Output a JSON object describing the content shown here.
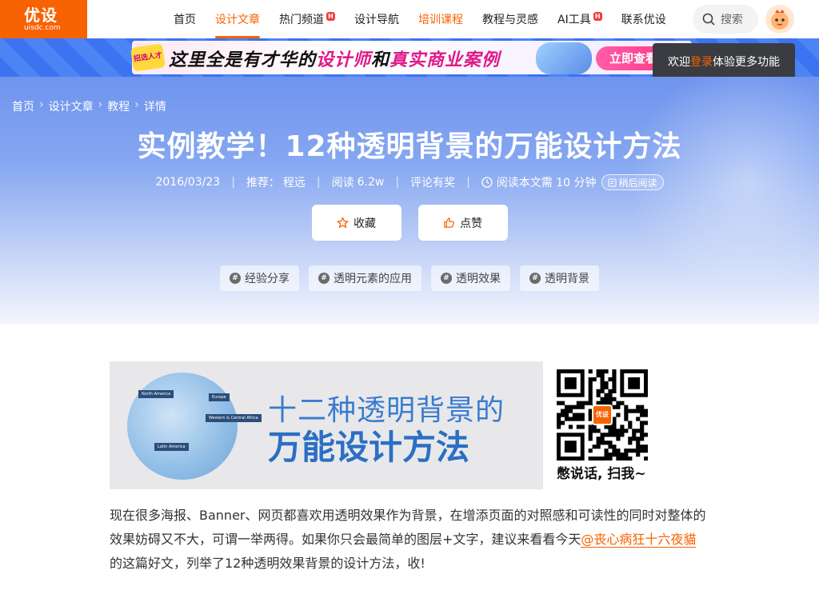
{
  "header": {
    "logo_main": "优设",
    "logo_sub": "uisdc.com",
    "nav": [
      {
        "label": "首页",
        "hot": false,
        "state": "normal"
      },
      {
        "label": "设计文章",
        "hot": false,
        "state": "active"
      },
      {
        "label": "热门频道",
        "hot": true,
        "state": "normal"
      },
      {
        "label": "设计导航",
        "hot": false,
        "state": "normal"
      },
      {
        "label": "培训课程",
        "hot": false,
        "state": "highlight"
      },
      {
        "label": "教程与灵感",
        "hot": false,
        "state": "normal"
      },
      {
        "label": "AI工具",
        "hot": true,
        "state": "normal"
      },
      {
        "label": "联系优设",
        "hot": false,
        "state": "normal"
      }
    ],
    "hot_badge": "H",
    "search_label": "搜索"
  },
  "ad": {
    "tag": "招选人才",
    "text_1": "这里全是有才华的",
    "text_2": "设计师",
    "text_3": "和",
    "text_4": "真实商业案例",
    "cta": "立即查看"
  },
  "tooltip": {
    "pre": "欢迎",
    "login": "登录",
    "post": "体验更多功能"
  },
  "breadcrumb": [
    "首页",
    "设计文章",
    "教程",
    "详情"
  ],
  "article": {
    "title": "实例教学！12种透明背景的万能设计方法",
    "date": "2016/03/23",
    "recommend_label": "推荐：",
    "recommender": "程远",
    "read_label": "阅读",
    "read_count": "6.2w",
    "comment": "评论有奖",
    "read_time": "阅读本文需 10 分钟",
    "read_later": "稍后阅读",
    "fav_label": "收藏",
    "like_label": "点赞",
    "tags": [
      "经验分享",
      "透明元素的应用",
      "透明效果",
      "透明背景"
    ],
    "banner_line1": "十二种透明背景的",
    "banner_line2": "万能设计方法",
    "globe_labels": [
      "North America",
      "Europe",
      "Western & Central Africa",
      "Latin America"
    ],
    "qr_logo": "优设",
    "qr_caption": "憋说话, 扫我~",
    "para_1": "现在很多海报、Banner、网页都喜欢用透明效果作为背景，在增添页面的对照感和可读性的同时对整体的效果妨碍又不大，可谓一举两得。如果你只会最简单的图层+文字，建议来看看今天",
    "mention": "@丧心病狂十六夜貓",
    "para_2": " 的这篇好文，列举了12种透明效果背景的设计方法，收!"
  },
  "colors": {
    "brand": "#f86200",
    "hero_top": "#6f94ee",
    "banner_text": "#2b6fc4"
  }
}
